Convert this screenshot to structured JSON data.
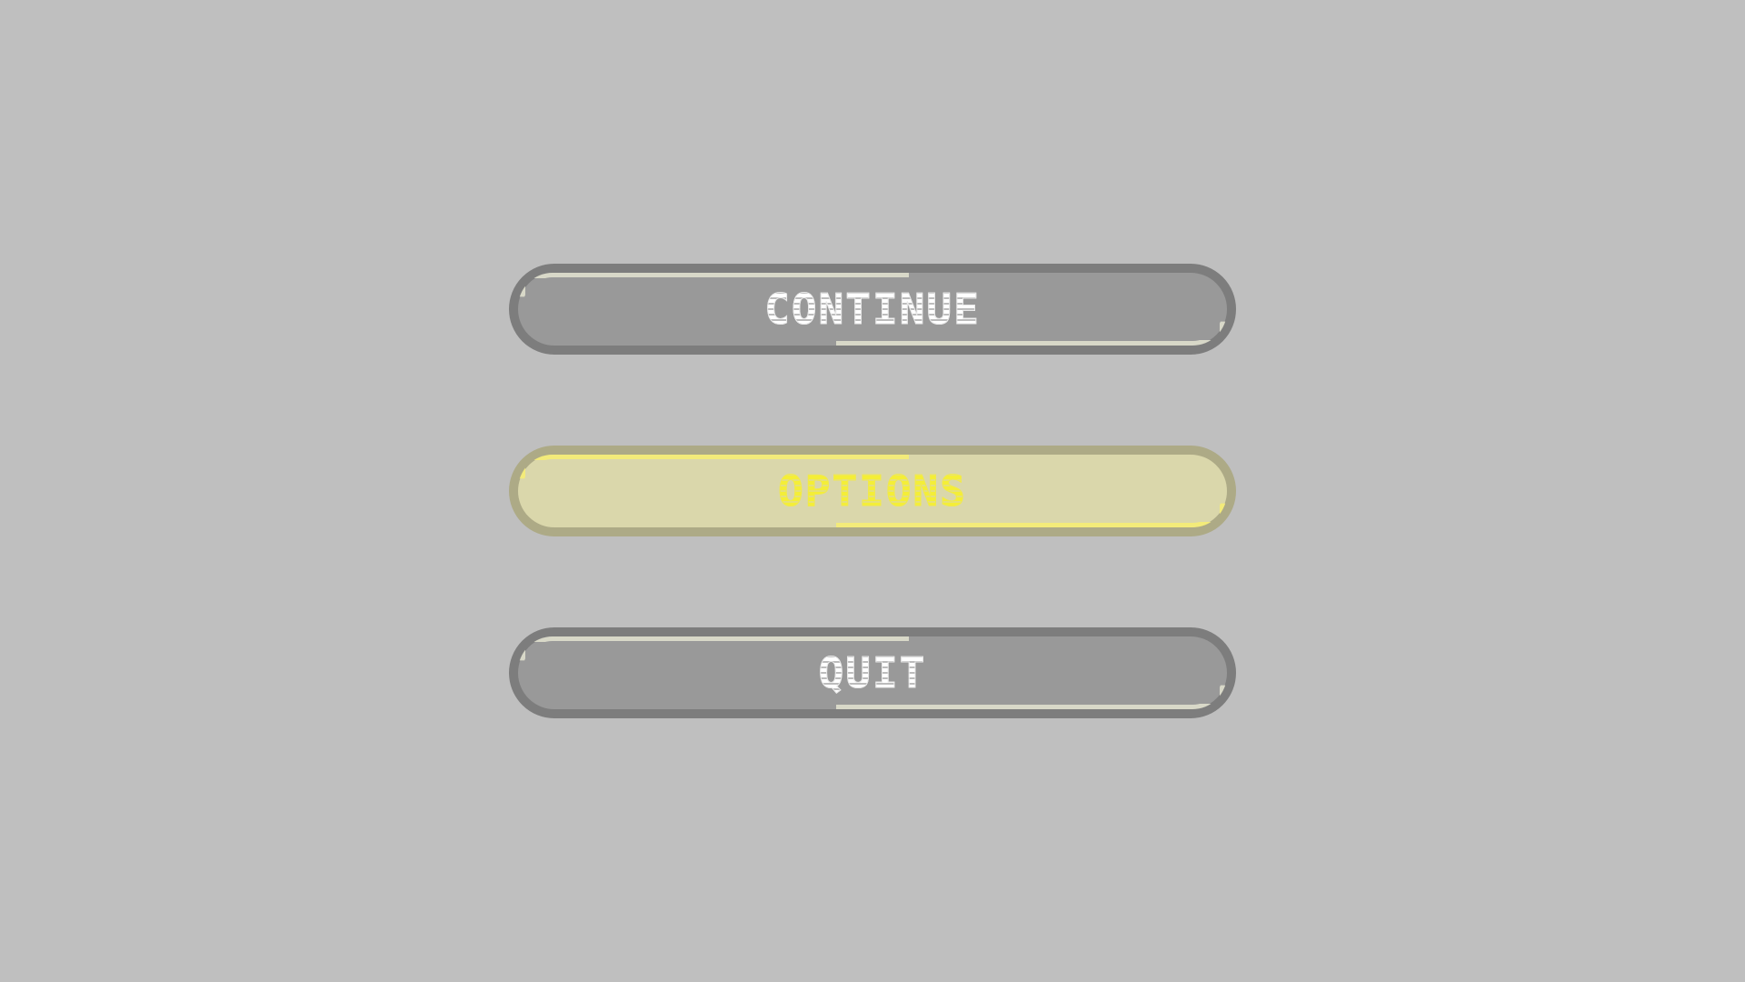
{
  "menu": {
    "items": [
      {
        "label": "CONTINUE",
        "selected": false
      },
      {
        "label": "OPTIONS",
        "selected": true
      },
      {
        "label": "QUIT",
        "selected": false
      }
    ]
  },
  "colors": {
    "background": "#bfbfbf",
    "button_fill": "#999999",
    "button_border": "#7d7d7d",
    "button_text": "#ffffff",
    "selected_fill": "#dad7ab",
    "selected_border": "#adaa86",
    "selected_text": "#f4ee37"
  }
}
